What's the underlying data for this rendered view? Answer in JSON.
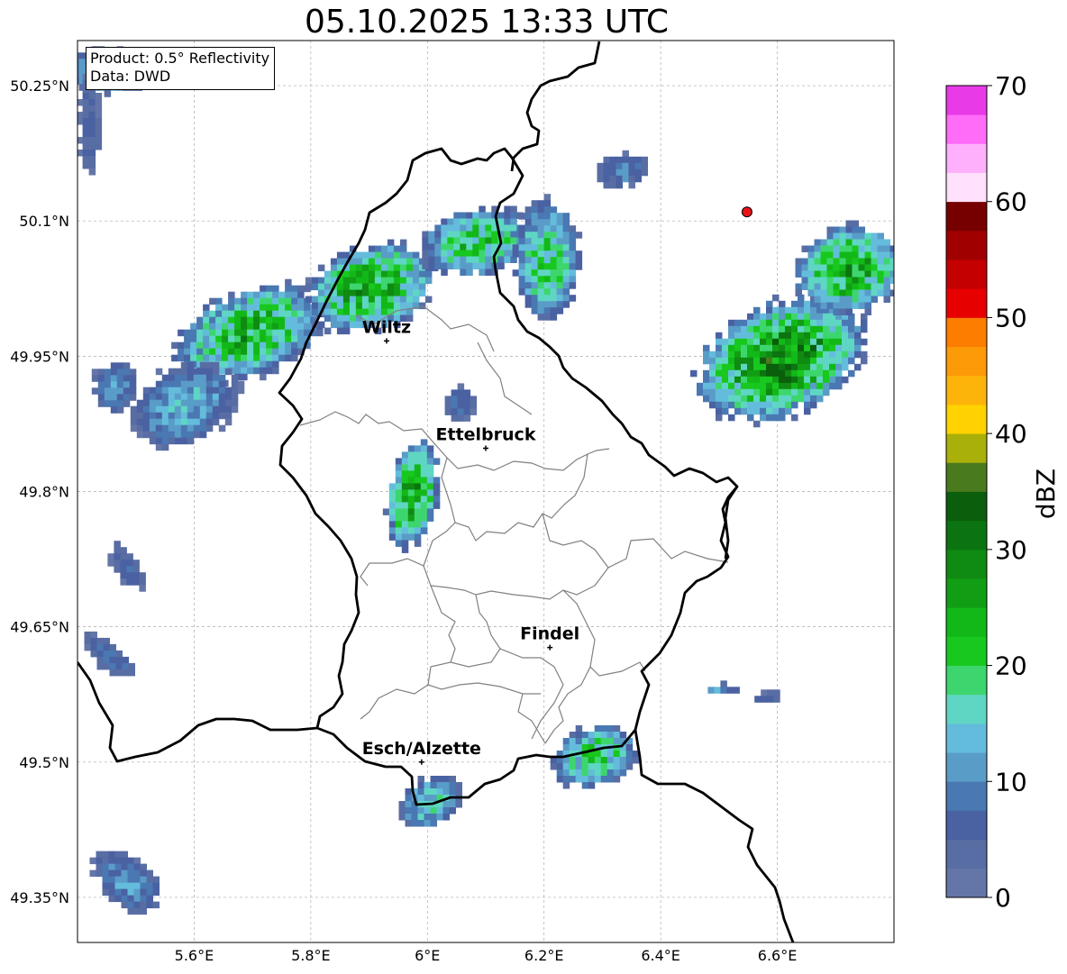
{
  "title": "05.10.2025 13:33 UTC",
  "info": {
    "product": "Product: 0.5° Reflectivity",
    "data": "Data: DWD"
  },
  "map": {
    "lon_range": [
      5.4,
      6.8
    ],
    "lat_range": [
      49.3,
      50.3
    ],
    "grid": true,
    "lat_ticks": [
      {
        "value": 50.25,
        "label": "50.25°N"
      },
      {
        "value": 50.1,
        "label": "50.1°N"
      },
      {
        "value": 49.95,
        "label": "49.95°N"
      },
      {
        "value": 49.8,
        "label": "49.8°N"
      },
      {
        "value": 49.65,
        "label": "49.65°N"
      },
      {
        "value": 49.5,
        "label": "49.5°N"
      },
      {
        "value": 49.35,
        "label": "49.35°N"
      }
    ],
    "lon_ticks": [
      {
        "value": 5.6,
        "label": "5.6°E"
      },
      {
        "value": 5.8,
        "label": "5.8°E"
      },
      {
        "value": 6.0,
        "label": "6°E"
      },
      {
        "value": 6.2,
        "label": "6.2°E"
      },
      {
        "value": 6.4,
        "label": "6.4°E"
      },
      {
        "value": 6.6,
        "label": "6.6°E"
      }
    ],
    "cities": [
      {
        "name": "Wiltz",
        "lon": 5.93,
        "lat": 49.967
      },
      {
        "name": "Ettelbruck",
        "lon": 6.1,
        "lat": 49.848
      },
      {
        "name": "Findel",
        "lon": 6.21,
        "lat": 49.627
      },
      {
        "name": "Esch/Alzette",
        "lon": 5.99,
        "lat": 49.5
      }
    ],
    "radar_site": {
      "lon": 6.548,
      "lat": 50.11,
      "color": "#e8141a"
    }
  },
  "colorbar": {
    "label": "dBZ",
    "min": 0,
    "max": 70,
    "step": 2.5,
    "ticks": [
      0,
      10,
      20,
      30,
      40,
      50,
      60,
      70
    ],
    "colors": [
      "#6476a8",
      "#586da3",
      "#4a61a2",
      "#4a78b2",
      "#5a9cc8",
      "#64bcdc",
      "#5fd6c4",
      "#3dd66e",
      "#18c81e",
      "#12b818",
      "#119e14",
      "#0f8a12",
      "#0b7410",
      "#0a5e0c",
      "#4a7a1e",
      "#aab00a",
      "#ffd200",
      "#fdb40a",
      "#fc9a08",
      "#fd7d00",
      "#e70000",
      "#c40000",
      "#a00000",
      "#760000",
      "#ffe0fd",
      "#ffb0fc",
      "#ff6cf8",
      "#e93ae8"
    ]
  },
  "echoes": [
    {
      "lon": 5.45,
      "lat": 50.27,
      "rx": 0.08,
      "ry": 0.025,
      "rot": 0,
      "peak": 22
    },
    {
      "lon": 5.415,
      "lat": 50.21,
      "rx": 0.02,
      "ry": 0.06,
      "rot": 0,
      "peak": 8
    },
    {
      "lon": 5.69,
      "lat": 49.98,
      "rx": 0.14,
      "ry": 0.05,
      "rot": -20,
      "peak": 28
    },
    {
      "lon": 5.58,
      "lat": 49.9,
      "rx": 0.1,
      "ry": 0.045,
      "rot": -30,
      "peak": 16
    },
    {
      "lon": 5.9,
      "lat": 50.03,
      "rx": 0.12,
      "ry": 0.05,
      "rot": -18,
      "peak": 30
    },
    {
      "lon": 6.08,
      "lat": 50.08,
      "rx": 0.1,
      "ry": 0.04,
      "rot": -10,
      "peak": 26
    },
    {
      "lon": 6.2,
      "lat": 50.06,
      "rx": 0.06,
      "ry": 0.07,
      "rot": 0,
      "peak": 24
    },
    {
      "lon": 6.33,
      "lat": 50.16,
      "rx": 0.05,
      "ry": 0.02,
      "rot": -10,
      "peak": 12
    },
    {
      "lon": 6.05,
      "lat": 49.9,
      "rx": 0.03,
      "ry": 0.02,
      "rot": 20,
      "peak": 10
    },
    {
      "lon": 5.97,
      "lat": 49.8,
      "rx": 0.045,
      "ry": 0.065,
      "rot": 10,
      "peak": 30
    },
    {
      "lon": 6.6,
      "lat": 49.95,
      "rx": 0.16,
      "ry": 0.065,
      "rot": -22,
      "peak": 34
    },
    {
      "lon": 6.72,
      "lat": 50.05,
      "rx": 0.1,
      "ry": 0.05,
      "rot": -15,
      "peak": 30
    },
    {
      "lon": 5.46,
      "lat": 49.92,
      "rx": 0.04,
      "ry": 0.03,
      "rot": 0,
      "peak": 14
    },
    {
      "lon": 5.48,
      "lat": 49.72,
      "rx": 0.05,
      "ry": 0.015,
      "rot": 55,
      "peak": 8
    },
    {
      "lon": 5.45,
      "lat": 49.62,
      "rx": 0.06,
      "ry": 0.016,
      "rot": 40,
      "peak": 10
    },
    {
      "lon": 5.48,
      "lat": 49.37,
      "rx": 0.07,
      "ry": 0.028,
      "rot": 40,
      "peak": 14
    },
    {
      "lon": 6.0,
      "lat": 49.46,
      "rx": 0.06,
      "ry": 0.028,
      "rot": -30,
      "peak": 20
    },
    {
      "lon": 6.28,
      "lat": 49.51,
      "rx": 0.08,
      "ry": 0.035,
      "rot": -15,
      "peak": 24
    },
    {
      "lon": 6.5,
      "lat": 49.585,
      "rx": 0.03,
      "ry": 0.006,
      "rot": 0,
      "peak": 16
    },
    {
      "lon": 6.58,
      "lat": 49.575,
      "rx": 0.03,
      "ry": 0.007,
      "rot": -10,
      "peak": 8
    }
  ]
}
